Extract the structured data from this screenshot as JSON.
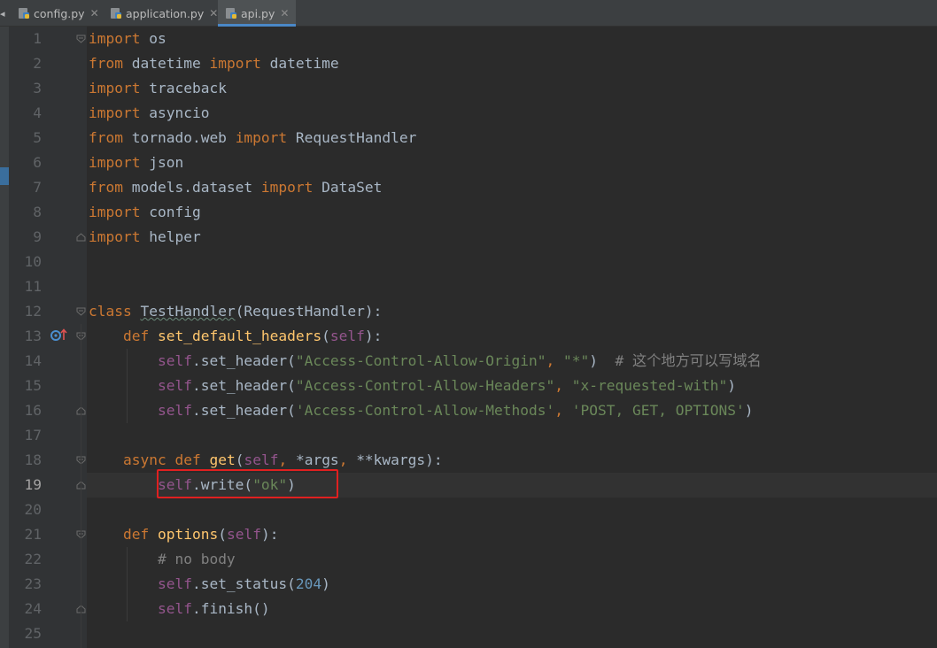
{
  "tabs": [
    {
      "label": "config.py",
      "active": false
    },
    {
      "label": "application.py",
      "active": false
    },
    {
      "label": "api.py",
      "active": true
    }
  ],
  "editor": {
    "current_line": 19,
    "line_numbers": [
      "1",
      "2",
      "3",
      "4",
      "5",
      "6",
      "7",
      "8",
      "9",
      "10",
      "11",
      "12",
      "13",
      "14",
      "15",
      "16",
      "17",
      "18",
      "19",
      "20",
      "21",
      "22",
      "23",
      "24",
      "25"
    ]
  },
  "code": {
    "l1": {
      "kw": "import",
      "rest": " os"
    },
    "l2": {
      "kw1": "from",
      "mid": " datetime ",
      "kw2": "import",
      "rest": " datetime"
    },
    "l3": {
      "kw": "import",
      "rest": " traceback"
    },
    "l4": {
      "kw": "import",
      "rest": " asyncio"
    },
    "l5": {
      "kw1": "from",
      "mid": " tornado.web ",
      "kw2": "import",
      "rest": " RequestHandler"
    },
    "l6": {
      "kw": "import",
      "rest": " json"
    },
    "l7": {
      "kw1": "from",
      "mid": " models.dataset ",
      "kw2": "import",
      "rest": " DataSet"
    },
    "l8": {
      "kw": "import",
      "rest": " config"
    },
    "l9": {
      "kw": "import",
      "rest": " helper"
    },
    "l12": {
      "kw": "class",
      "name": "TestHandler",
      "rest": "(RequestHandler):"
    },
    "l13": {
      "kw": "def",
      "fn": "set_default_headers",
      "open": "(",
      "self": "self",
      "close": "):"
    },
    "l14": {
      "self": "self",
      "call": ".set_header(",
      "s1": "\"Access-Control-Allow-Origin\"",
      "sep": ", ",
      "s2": "\"*\"",
      "close": ")",
      "comment": "# 这个地方可以写域名"
    },
    "l15": {
      "self": "self",
      "call": ".set_header(",
      "s1": "\"Access-Control-Allow-Headers\"",
      "sep": ", ",
      "s2": "\"x-requested-with\"",
      "close": ")"
    },
    "l16": {
      "self": "self",
      "call": ".set_header(",
      "s1": "'Access-Control-Allow-Methods'",
      "sep": ", ",
      "s2": "'POST, GET, OPTIONS'",
      "close": ")"
    },
    "l18": {
      "kw1": "async",
      "kw2": "def",
      "fn": "get",
      "open": "(",
      "self": "self",
      "a1": ", ",
      "args": "*args",
      "a2": ", ",
      "kwargs": "**kwargs",
      "close": "):"
    },
    "l19": {
      "self": "self",
      "call": ".write(",
      "s1": "\"ok\"",
      "close": ")"
    },
    "l21": {
      "kw": "def",
      "fn": "options",
      "open": "(",
      "self": "self",
      "close": "):"
    },
    "l22": {
      "comment": "# no body"
    },
    "l23": {
      "self": "self",
      "call": ".set_status(",
      "num": "204",
      "close": ")"
    },
    "l24": {
      "self": "self",
      "call": ".finish()"
    }
  },
  "colors": {
    "keyword": "#cc7832",
    "self": "#94558d",
    "string": "#6a8759",
    "comment": "#808080",
    "function": "#ffc66d",
    "number": "#6897bb",
    "default": "#a9b7c6",
    "highlight_box": "#e02020"
  }
}
